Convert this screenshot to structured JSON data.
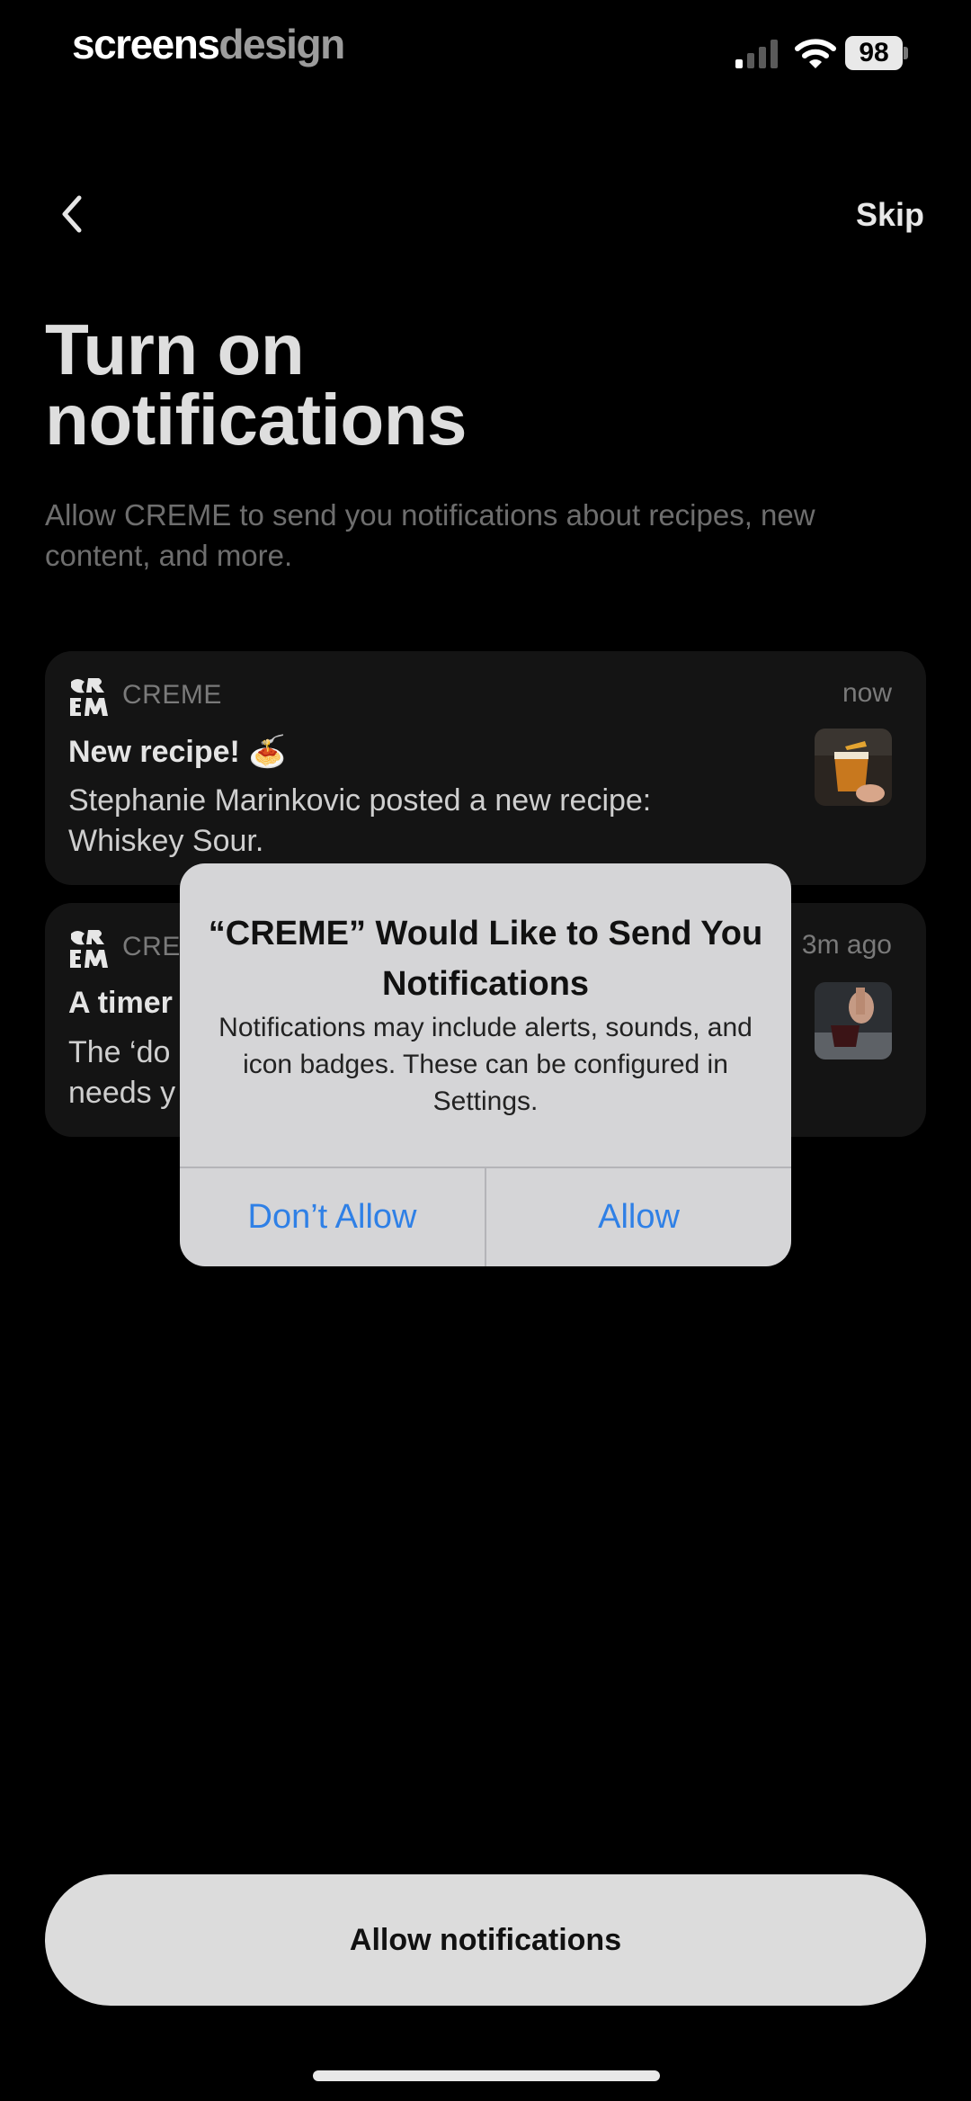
{
  "status_bar": {
    "brand_part1": "screens",
    "brand_part2": "design",
    "battery": "98"
  },
  "nav": {
    "skip_label": "Skip"
  },
  "header": {
    "title_line1": "Turn on",
    "title_line2": "notifications",
    "subtitle": "Allow CREME to send you notifications about recipes, new content, and more."
  },
  "notifications": [
    {
      "app": "CREME",
      "time": "now",
      "title": "New recipe! 🍝",
      "body": "Stephanie Marinkovic posted a new recipe: Whiskey Sour."
    },
    {
      "app": "CRE",
      "time": "3m ago",
      "title": "A timer",
      "body_line1": "The ‘do",
      "body_line2": "needs y"
    }
  ],
  "alert": {
    "title": "“CREME” Would Like to Send You Notifications",
    "message": "Notifications may include alerts, sounds, and icon badges. These can be configured in Settings.",
    "dont_allow": "Don’t Allow",
    "allow": "Allow",
    "button_color": "#2F80E6"
  },
  "cta": {
    "label": "Allow notifications"
  },
  "icons": [
    "chevron-left-icon",
    "cellular-signal-icon",
    "wifi-icon",
    "battery-icon",
    "creme-logo-icon"
  ]
}
